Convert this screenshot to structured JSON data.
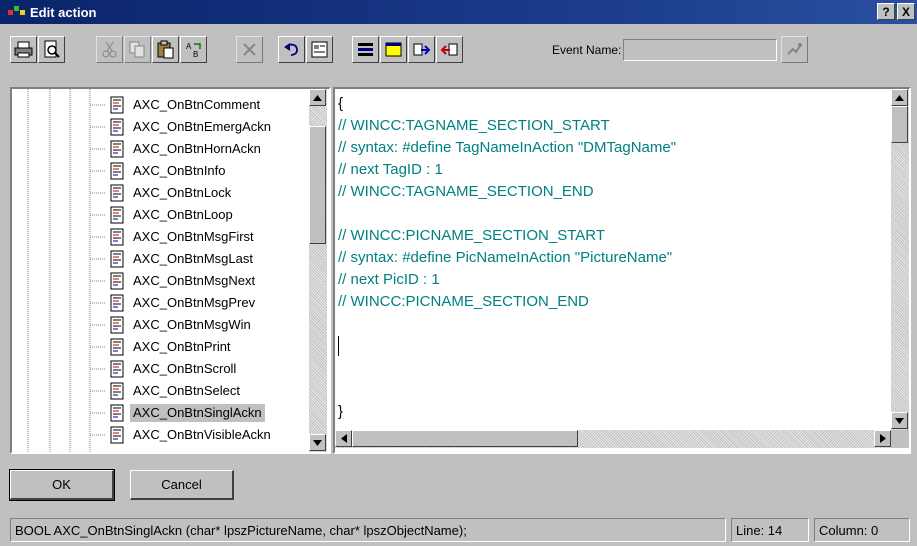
{
  "window": {
    "title": "Edit action",
    "help_label": "?",
    "close_label": "X"
  },
  "toolbar": {
    "icons": [
      "print-icon",
      "print-preview-icon",
      "cut-icon",
      "copy-icon",
      "paste-icon",
      "find-replace-icon",
      "delete-icon",
      "undo-icon",
      "properties-icon",
      "tag-icon",
      "window-icon",
      "import-icon",
      "export-icon"
    ],
    "event_name_label": "Event Name:",
    "event_name_value": ""
  },
  "tree": {
    "items": [
      {
        "label": "AXC_OnBtnComment",
        "selected": false
      },
      {
        "label": "AXC_OnBtnEmergAckn",
        "selected": false
      },
      {
        "label": "AXC_OnBtnHornAckn",
        "selected": false
      },
      {
        "label": "AXC_OnBtnInfo",
        "selected": false
      },
      {
        "label": "AXC_OnBtnLock",
        "selected": false
      },
      {
        "label": "AXC_OnBtnLoop",
        "selected": false
      },
      {
        "label": "AXC_OnBtnMsgFirst",
        "selected": false
      },
      {
        "label": "AXC_OnBtnMsgLast",
        "selected": false
      },
      {
        "label": "AXC_OnBtnMsgNext",
        "selected": false
      },
      {
        "label": "AXC_OnBtnMsgPrev",
        "selected": false
      },
      {
        "label": "AXC_OnBtnMsgWin",
        "selected": false
      },
      {
        "label": "AXC_OnBtnPrint",
        "selected": false
      },
      {
        "label": "AXC_OnBtnScroll",
        "selected": false
      },
      {
        "label": "AXC_OnBtnSelect",
        "selected": false
      },
      {
        "label": "AXC_OnBtnSinglAckn",
        "selected": true
      },
      {
        "label": "AXC_OnBtnVisibleAckn",
        "selected": false
      }
    ]
  },
  "editor": {
    "lines": [
      {
        "text": "{",
        "kind": "plain"
      },
      {
        "text": "// WINCC:TAGNAME_SECTION_START",
        "kind": "comment"
      },
      {
        "text": "// syntax: #define TagNameInAction \"DMTagName\"",
        "kind": "comment"
      },
      {
        "text": "// next TagID : 1",
        "kind": "comment"
      },
      {
        "text": "// WINCC:TAGNAME_SECTION_END",
        "kind": "comment"
      },
      {
        "text": "",
        "kind": "plain"
      },
      {
        "text": "// WINCC:PICNAME_SECTION_START",
        "kind": "comment"
      },
      {
        "text": "// syntax: #define PicNameInAction \"PictureName\"",
        "kind": "comment"
      },
      {
        "text": "// next PicID : 1",
        "kind": "comment"
      },
      {
        "text": "// WINCC:PICNAME_SECTION_END",
        "kind": "comment"
      },
      {
        "text": "",
        "kind": "plain"
      },
      {
        "text": "",
        "kind": "plain"
      },
      {
        "text": "",
        "kind": "plain"
      },
      {
        "text": "",
        "kind": "plain"
      },
      {
        "text": "}",
        "kind": "plain"
      }
    ]
  },
  "buttons": {
    "ok": "OK",
    "cancel": "Cancel"
  },
  "status": {
    "signature": "BOOL AXC_OnBtnSinglAckn (char* lpszPictureName, char* lpszObjectName);",
    "line": "Line: 14",
    "column": "Column: 0"
  },
  "colors": {
    "title_bar": "#0a246a",
    "comment_text": "#008080",
    "face": "#c0c0c0"
  }
}
